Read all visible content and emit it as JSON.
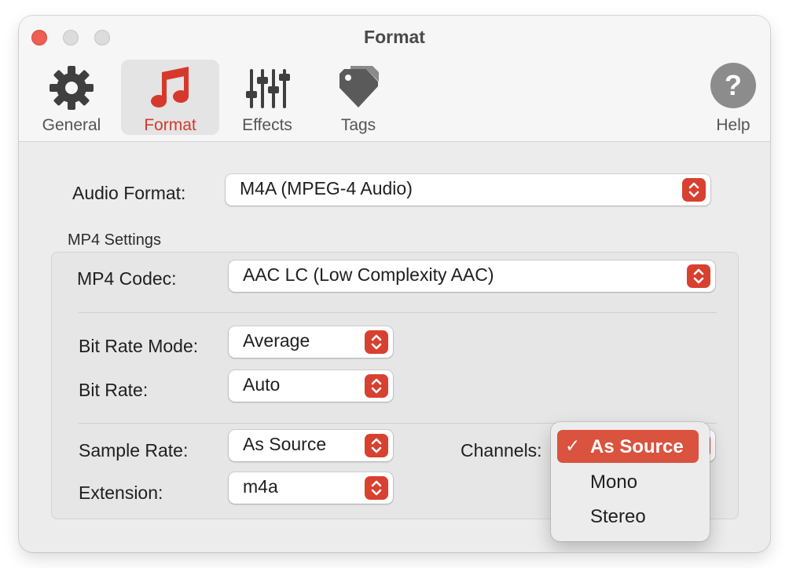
{
  "window": {
    "title": "Format"
  },
  "toolbar": {
    "items": [
      {
        "label": "General",
        "icon": "gear-icon"
      },
      {
        "label": "Format",
        "icon": "music-note-icon",
        "selected": true
      },
      {
        "label": "Effects",
        "icon": "sliders-icon"
      },
      {
        "label": "Tags",
        "icon": "tag-icon"
      },
      {
        "label": "Help",
        "icon": "help-icon"
      }
    ]
  },
  "audio_format": {
    "label": "Audio Format:",
    "value": "M4A (MPEG-4 Audio)"
  },
  "mp4_settings": {
    "title": "MP4 Settings",
    "codec": {
      "label": "MP4 Codec:",
      "value": "AAC LC (Low Complexity AAC)"
    },
    "bit_rate_mode": {
      "label": "Bit Rate Mode:",
      "value": "Average"
    },
    "bit_rate": {
      "label": "Bit Rate:",
      "value": "Auto"
    },
    "sample_rate": {
      "label": "Sample Rate:",
      "value": "As Source"
    },
    "extension": {
      "label": "Extension:",
      "value": "m4a"
    },
    "channels": {
      "label": "Channels:",
      "options": [
        "As Source",
        "Mono",
        "Stereo"
      ],
      "selected": "As Source",
      "check_mark": "✓"
    }
  },
  "colors": {
    "accent": "#d8402f",
    "close_button": "#ee5e55",
    "window_bg": "#ececec"
  }
}
